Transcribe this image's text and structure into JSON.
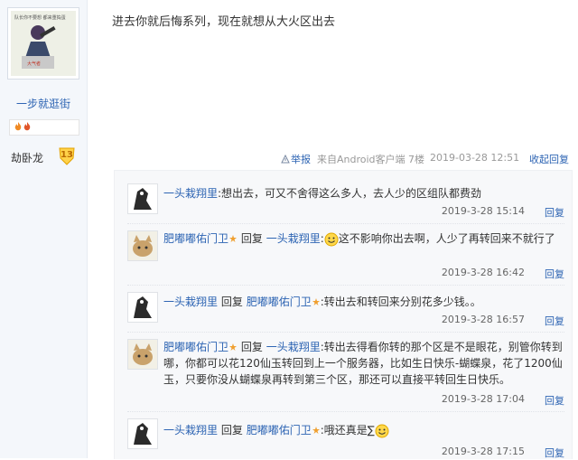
{
  "author": {
    "name": "一步就逛街",
    "badge_name": "劫卧龙",
    "badge_level": "13"
  },
  "post": {
    "content": "进去你就后悔系列，现在就想从大火区出去",
    "report": "举报",
    "source": "来自Android客户端",
    "floor": "7楼",
    "time": "2019-03-28 12:51",
    "collapse": "收起回复"
  },
  "comments": [
    {
      "user": "一头栽翔里",
      "reply_word": "",
      "target": "",
      "text": ":想出去，可又不舍得这么多人，去人少的区组队都费劲",
      "time": "2019-3-28 15:14",
      "reply": "回复",
      "emoji": ""
    },
    {
      "user": "肥嘟嘟佑门卫",
      "reply_word": "回复",
      "target": "一头栽翔里",
      "text": "这不影响你出去啊，人少了再转回来不就行了",
      "time": "2019-3-28 16:42",
      "reply": "回复",
      "emoji": "smile-emoji"
    },
    {
      "user": "一头栽翔里",
      "reply_word": "回复",
      "target": "肥嘟嘟佑门卫",
      "text": ":转出去和转回来分别花多少钱。。",
      "time": "2019-3-28 16:57",
      "reply": "回复",
      "emoji": ""
    },
    {
      "user": "肥嘟嘟佑门卫",
      "reply_word": "回复",
      "target": "一头栽翔里",
      "text": ":转出去得看你转的那个区是不是眼花，别管你转到哪，你都可以花120仙玉转回到上一个服务器，比如生日快乐-蝴蝶泉，花了1200仙玉，只要你没从蝴蝶泉再转到第三个区，那还可以直接平转回生日快乐。",
      "time": "2019-3-28 17:04",
      "reply": "回复",
      "emoji": ""
    },
    {
      "user": "一头栽翔里",
      "reply_word": "回复",
      "target": "肥嘟嘟佑门卫",
      "text": ":哦还真是∑",
      "time": "2019-3-28 17:15",
      "reply": "回复",
      "emoji": "smile-emoji"
    }
  ]
}
